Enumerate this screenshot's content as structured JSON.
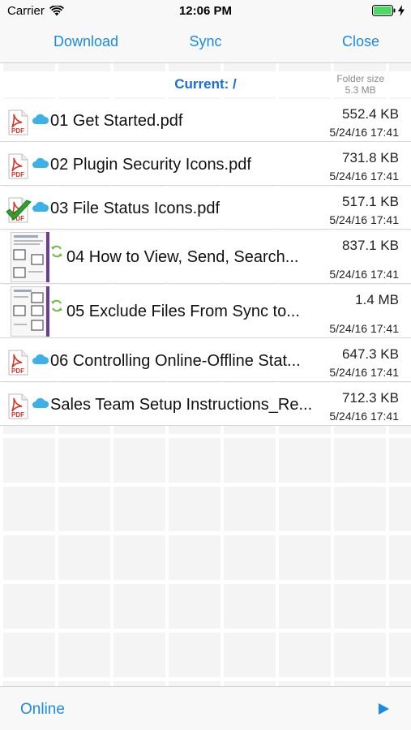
{
  "status_bar": {
    "carrier": "Carrier",
    "time": "12:06 PM"
  },
  "nav": {
    "download_label": "Download",
    "sync_label": "Sync",
    "close_label": "Close"
  },
  "folder": {
    "current_label": "Current: /",
    "size_caption": "Folder size",
    "size_value": "5.3 MB"
  },
  "files": [
    {
      "name": "01 Get Started.pdf",
      "size": "552.4 KB",
      "date": "5/24/16 17:41",
      "icon": "pdf-icon",
      "status_icon": "cloud-icon"
    },
    {
      "name": "02 Plugin Security Icons.pdf",
      "size": "731.8 KB",
      "date": "5/24/16 17:41",
      "icon": "pdf-icon",
      "status_icon": "cloud-icon"
    },
    {
      "name": "03 File Status Icons.pdf",
      "size": "517.1 KB",
      "date": "5/24/16 17:41",
      "icon": "pdf-icon",
      "status_icon": "cloud-icon",
      "badge_icon": "checkmark-icon"
    },
    {
      "name": "04 How to View, Send, Search...",
      "size": "837.1 KB",
      "date": "5/24/16 17:41",
      "icon": "document-thumbnail",
      "status_icon": "sync-icon"
    },
    {
      "name": "05 Exclude Files From Sync to...",
      "size": "1.4 MB",
      "date": "5/24/16 17:41",
      "icon": "document-thumbnail",
      "status_icon": "sync-icon"
    },
    {
      "name": "06 Controlling Online-Offline Stat...",
      "size": "647.3 KB",
      "date": "5/24/16 17:41",
      "icon": "pdf-icon",
      "status_icon": "cloud-icon"
    },
    {
      "name": "Sales Team Setup Instructions_Re...",
      "size": "712.3 KB",
      "date": "5/24/16 17:41",
      "icon": "pdf-icon",
      "status_icon": "cloud-icon"
    }
  ],
  "pdf_icon_label": "PDF",
  "bottom_bar": {
    "online_label": "Online"
  },
  "colors": {
    "accent": "#1a8ae5",
    "header_blue": "#1a6fd6",
    "pdf_red": "#d9342b",
    "cloud_blue": "#3cb0e8",
    "sync_green": "#6bbf3a",
    "check_green": "#2ea12e",
    "battery_green": "#4cd964"
  }
}
